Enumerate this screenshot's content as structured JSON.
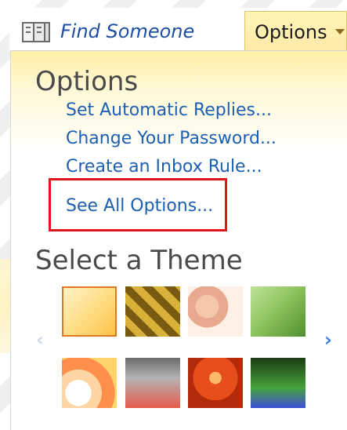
{
  "header": {
    "find_someone_label": "Find Someone",
    "options_tab_label": "Options"
  },
  "panel": {
    "title": "Options",
    "links": [
      "Set Automatic Replies...",
      "Change Your Password...",
      "Create an Inbox Rule...",
      "See All Options..."
    ],
    "theme_title": "Select a Theme"
  },
  "themes": {
    "selected_index": 0,
    "count": 8
  },
  "colors": {
    "link": "#1d5fb3",
    "highlight_box": "#e0151b",
    "selected_theme_border": "#e07a21",
    "tab_bg": "#fff6b8"
  },
  "icons": {
    "find_someone": "address-book-icon",
    "options_caret": "caret-down-icon",
    "nav_left": "chevron-left-icon",
    "nav_right": "chevron-right-icon"
  }
}
